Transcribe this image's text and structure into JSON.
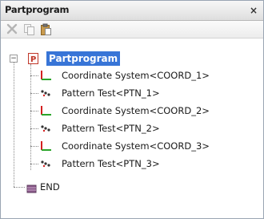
{
  "window": {
    "title": "Partprogram",
    "close_glyph": "×"
  },
  "toolbar": {
    "buttons": [
      {
        "name": "delete-icon"
      },
      {
        "name": "copy-icon"
      },
      {
        "name": "paste-icon"
      }
    ]
  },
  "tree": {
    "root": {
      "label": "Partprogram",
      "icon": "partprogram-icon",
      "expanded": true
    },
    "items": [
      {
        "label": "Coordinate System<COORD_1>",
        "icon": "coordinate-system-icon"
      },
      {
        "label": "Pattern Test<PTN_1>",
        "icon": "pattern-test-icon"
      },
      {
        "label": "Coordinate System<COORD_2>",
        "icon": "coordinate-system-icon"
      },
      {
        "label": "Pattern Test<PTN_2>",
        "icon": "pattern-test-icon"
      },
      {
        "label": "Coordinate System<COORD_3>",
        "icon": "coordinate-system-icon"
      },
      {
        "label": "Pattern Test<PTN_3>",
        "icon": "pattern-test-icon"
      }
    ],
    "end": {
      "label": "END",
      "icon": "end-icon"
    }
  },
  "colors": {
    "selection": "#3875d7",
    "coord_x_axis": "#d42020",
    "coord_y_axis": "#2aa52a",
    "end_icon": "#8a5a8a"
  }
}
